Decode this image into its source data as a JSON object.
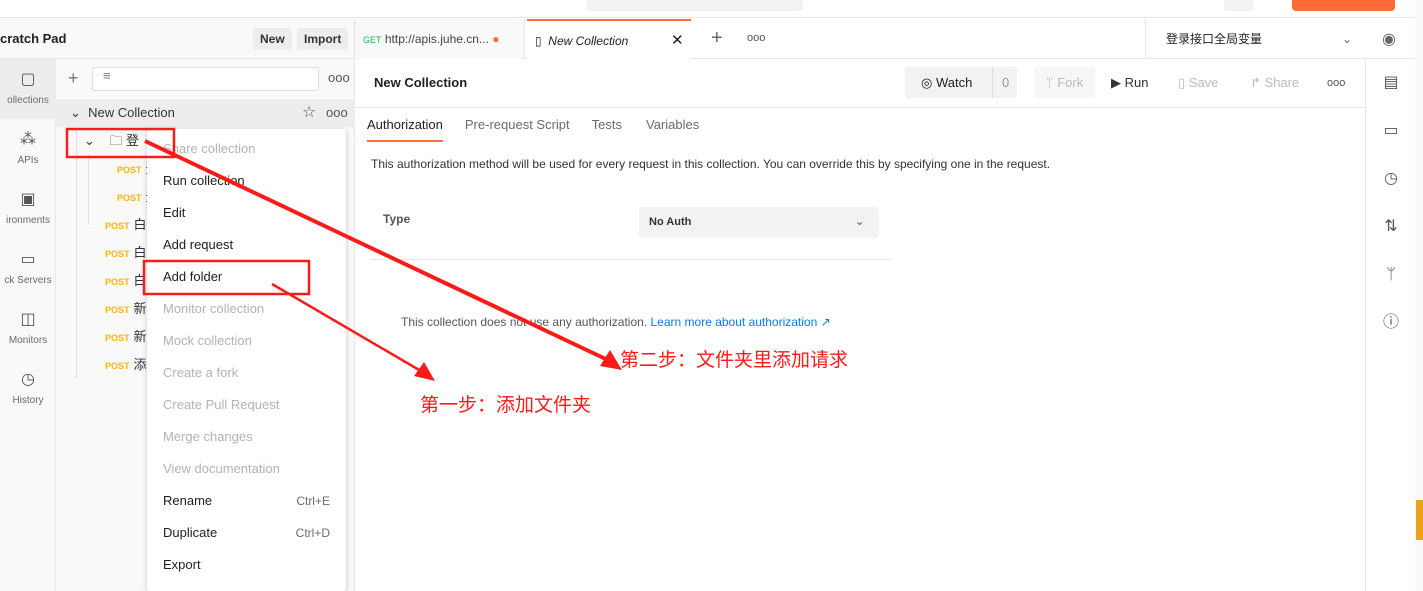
{
  "sidebar": {
    "title": "cratch Pad",
    "new": "New",
    "import": "Import",
    "icons": [
      {
        "label": "ollections",
        "icon": "collection-icon"
      },
      {
        "label": "APIs",
        "icon": "apis-icon"
      },
      {
        "label": "ironments",
        "icon": "environment-icon"
      },
      {
        "label": "ck Servers",
        "icon": "mock-server-icon"
      },
      {
        "label": "Monitors",
        "icon": "monitor-icon"
      },
      {
        "label": "History",
        "icon": "history-icon"
      }
    ],
    "collection": "New Collection",
    "folder": "登",
    "method": "POST",
    "requests": [
      "登",
      "登",
      "白",
      "白",
      "白",
      "新",
      "新",
      "添"
    ]
  },
  "menu": {
    "items": [
      {
        "label": "Share collection",
        "disabled": true
      },
      {
        "label": "Run collection"
      },
      {
        "label": "Edit"
      },
      {
        "label": "Add request"
      },
      {
        "label": "Add folder"
      },
      {
        "label": "Monitor collection",
        "disabled": true
      },
      {
        "label": "Mock collection",
        "disabled": true
      },
      {
        "label": "Create a fork",
        "disabled": true
      },
      {
        "label": "Create Pull Request",
        "disabled": true
      },
      {
        "label": "Merge changes",
        "disabled": true
      },
      {
        "label": "View documentation",
        "disabled": true
      },
      {
        "label": "Rename",
        "shortcut": "Ctrl+E"
      },
      {
        "label": "Duplicate",
        "shortcut": "Ctrl+D"
      },
      {
        "label": "Export"
      }
    ]
  },
  "tabs": {
    "tab1_method": "GET",
    "tab1_url": "http://apis.juhe.cn...",
    "tab2": "New Collection",
    "env": "登录接口全局变量"
  },
  "main": {
    "title": "New Collection",
    "watch": "Watch",
    "watch_count": "0",
    "fork": "Fork",
    "run": "Run",
    "save": "Save",
    "share": "Share",
    "subtabs": [
      "Authorization",
      "Pre-request Script",
      "Tests",
      "Variables"
    ],
    "desc": "This authorization method will be used for every request in this collection. You can override this by specifying one in the request.",
    "type_label": "Type",
    "type_value": "No Auth",
    "noauth": "This collection does not use any authorization.",
    "learn": "Learn more about authorization ↗"
  },
  "annotations": {
    "step2": "第二步：文件夹里添加请求",
    "step1": "第一步：添加文件夹",
    "color": "#ff1a1a"
  }
}
